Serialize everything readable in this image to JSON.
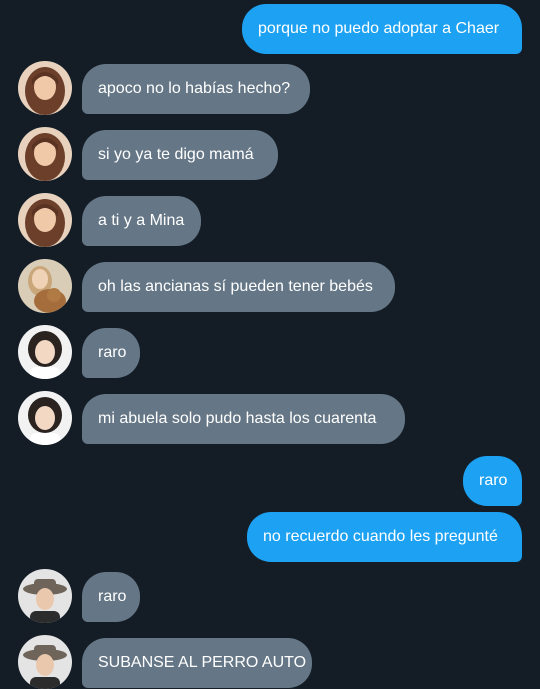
{
  "messages": [
    {
      "side": "out",
      "text": "porque no puedo adoptar a Chaer"
    },
    {
      "side": "in",
      "avatar": "avatar-woman-long-hair",
      "text": "apoco no lo habías hecho?"
    },
    {
      "side": "in",
      "avatar": "avatar-woman-long-hair",
      "text": "si yo ya te digo mamá"
    },
    {
      "side": "in",
      "avatar": "avatar-woman-long-hair",
      "text": "a ti y a Mina"
    },
    {
      "side": "in",
      "avatar": "avatar-woman-with-dog",
      "text": "oh las ancianas sí pueden tener bebés"
    },
    {
      "side": "in",
      "avatar": "avatar-woman-curly-hair",
      "text": "raro"
    },
    {
      "side": "in",
      "avatar": "avatar-woman-curly-hair",
      "text": "mi abuela solo pudo hasta los cuarenta"
    },
    {
      "side": "out",
      "text": "raro"
    },
    {
      "side": "out",
      "text": "no recuerdo cuando les pregunté"
    },
    {
      "side": "in",
      "avatar": "avatar-person-hat",
      "text": "raro"
    },
    {
      "side": "in",
      "avatar": "avatar-person-hat",
      "text": "SUBANSE AL PERRO AUTO"
    }
  ],
  "colors": {
    "background": "#141d26",
    "outgoing_bubble": "#1da1f2",
    "incoming_bubble": "#657786",
    "text": "#ffffff"
  }
}
